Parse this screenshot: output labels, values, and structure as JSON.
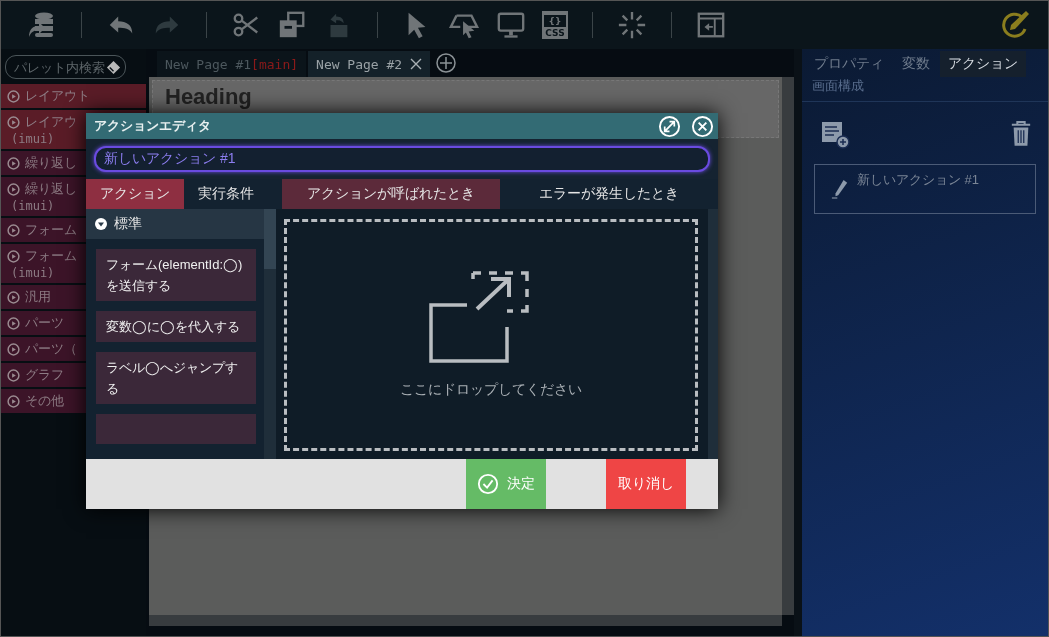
{
  "toolbar": {
    "groups": [
      [
        {
          "kind": "database",
          "disabled": false
        }
      ],
      [
        {
          "kind": "undo",
          "disabled": false
        },
        {
          "kind": "redo",
          "disabled": true
        }
      ],
      [
        {
          "kind": "scissors",
          "disabled": false
        },
        {
          "kind": "copy",
          "disabled": false
        },
        {
          "kind": "paste",
          "disabled": true
        }
      ],
      [
        {
          "kind": "pointer",
          "disabled": false
        },
        {
          "kind": "area-pointer",
          "disabled": false
        },
        {
          "kind": "monitor",
          "disabled": false
        },
        {
          "kind": "css",
          "disabled": false,
          "lines": [
            "{}",
            "CSS"
          ]
        }
      ],
      [
        {
          "kind": "spinner",
          "disabled": false
        }
      ],
      [
        {
          "kind": "panel",
          "disabled": false
        }
      ]
    ],
    "right": {
      "kind": "edit",
      "disabled": false
    }
  },
  "palette": {
    "search": {
      "placeholder": "パレット内検索"
    },
    "items": [
      {
        "label": "レイアウト",
        "color": "#5a1c27"
      },
      {
        "label": "レイアウ",
        "sub": "(imui)",
        "color": "#5a1c27"
      },
      {
        "label": "繰り返し",
        "color": "#3c1428"
      },
      {
        "label": "繰り返し",
        "sub": "(imui)",
        "color": "#3c1428"
      },
      {
        "label": "フォーム",
        "color": "#3c1428"
      },
      {
        "label": "フォーム",
        "sub": "(imui)",
        "color": "#3c1428"
      },
      {
        "label": "汎用",
        "color": "#3c1428"
      },
      {
        "label": "パーツ",
        "color": "#3c1428"
      },
      {
        "label": "パーツ（",
        "color": "#3c1428"
      },
      {
        "label": "グラフ",
        "color": "#3c1428"
      },
      {
        "label": "その他",
        "color": "#3c1428"
      }
    ]
  },
  "page_tabs": [
    {
      "label": "New Page #1",
      "tag": "[main]",
      "selected": false,
      "closable": false
    },
    {
      "label": "New Page #2",
      "selected": true,
      "closable": true
    }
  ],
  "canvas": {
    "heading": "Heading"
  },
  "right_panel": {
    "tabs": [
      {
        "label": "プロパティ",
        "selected": false
      },
      {
        "label": "変数",
        "selected": false
      },
      {
        "label": "アクション",
        "selected": true
      }
    ],
    "sub_tabs": [
      {
        "label": "画面構成",
        "selected": false
      }
    ],
    "actions": [
      {
        "label": "新しいアクション #1"
      }
    ]
  },
  "dialog": {
    "title": "アクションエディタ",
    "name_field": {
      "value": "新しいアクション #1"
    },
    "left_tabs": [
      {
        "label": "アクション",
        "selected": true
      },
      {
        "label": "実行条件",
        "selected": false
      }
    ],
    "right_tabs": [
      {
        "label": "アクションが呼ばれたとき",
        "selected": true
      },
      {
        "label": "エラーが発生したとき",
        "selected": false
      }
    ],
    "category": {
      "label": "標準",
      "expanded": true
    },
    "actions": [
      "フォーム(elementId:◯)を送信する",
      "変数◯に◯を代入する",
      "ラベル◯へジャンプする"
    ],
    "drop_hint": "ここにドロップしてください",
    "buttons": [
      {
        "kind": "ok",
        "label": "決定"
      },
      {
        "kind": "cancel",
        "label": "取り消し"
      }
    ]
  }
}
